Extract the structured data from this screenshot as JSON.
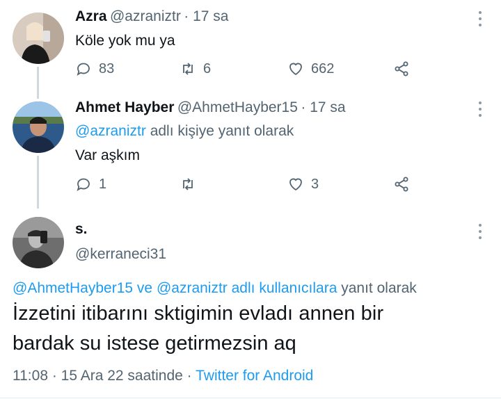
{
  "tweets": [
    {
      "name": "Azra",
      "handle": "@azraniztr",
      "time": "· 17 sa",
      "text": "Köle yok mu ya",
      "replies": "83",
      "retweets": "6",
      "likes": "662"
    },
    {
      "name": "Ahmet Hayber",
      "handle": "@AhmetHayber15",
      "time": "· 17 sa",
      "reply_to_link": "@azraniztr",
      "reply_to_suffix": "adlı kişiye yanıt olarak",
      "text": "Var aşkım",
      "replies": "1",
      "retweets": "",
      "likes": "3"
    }
  ],
  "main_tweet": {
    "name": "s.",
    "handle": "@kerraneci31",
    "reply_link_1": "@AhmetHayber15",
    "reply_and": "ve",
    "reply_link_2": "@azraniztr adlı kullanıcılara",
    "reply_suffix": "yanıt olarak",
    "text_line_1": "İzzetini itibarını sktigimin evladı annen bir",
    "text_line_2": "bardak su istese getirmezsin aq",
    "time": "11:08",
    "date": "· 15 Ara 22 saatinde ·",
    "source": "Twitter for Android"
  },
  "colors": {
    "link": "#1d9bf0",
    "muted": "#536471",
    "text": "#0f1419"
  }
}
